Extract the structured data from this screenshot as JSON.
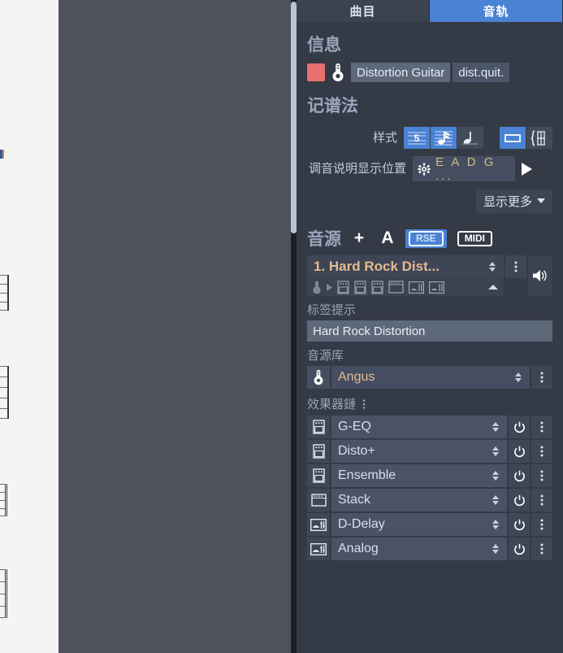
{
  "tabs": [
    {
      "label": "曲目",
      "active": false,
      "name": "tab-songs"
    },
    {
      "label": "音轨",
      "active": true,
      "name": "tab-tracks"
    }
  ],
  "info": {
    "heading": "信息",
    "color_swatch": "#e8706e",
    "instrument_name": "Distortion Guitar",
    "short_name": "dist.quit."
  },
  "notation": {
    "heading": "记谱法",
    "style_label": "样式",
    "style_buttons": [
      {
        "icon": "tab-number-icon",
        "active": true
      },
      {
        "icon": "standard-notation-icon",
        "active": true
      },
      {
        "icon": "slash-notation-icon",
        "active": false
      },
      {
        "icon": "single-staff-icon",
        "active": true
      },
      {
        "icon": "grand-staff-icon",
        "active": false
      }
    ],
    "tuning_label": "调音说明显示位置",
    "tuning_value": "E A D G ...",
    "show_more_label": "显示更多"
  },
  "source": {
    "heading": "音源",
    "buttons": [
      {
        "label": "+",
        "name": "add-source-button"
      },
      {
        "label": "A",
        "name": "automation-button"
      }
    ],
    "modes": [
      {
        "label": "RSE",
        "active": true
      },
      {
        "label": "MIDI",
        "active": false
      }
    ],
    "preset_name": "1. Hard Rock Dist...",
    "tag_label": "标签提示",
    "tag_value": "Hard Rock Distortion",
    "library_label": "音源库",
    "library_value": "Angus",
    "chain_label": "效果器鏈",
    "effects": [
      {
        "name": "G-EQ",
        "icon": "pedal-icon",
        "enabled": true
      },
      {
        "name": "Disto+",
        "icon": "pedal-icon",
        "enabled": true
      },
      {
        "name": "Ensemble",
        "icon": "pedal-icon",
        "enabled": true
      },
      {
        "name": "Stack",
        "icon": "amp-stack-icon",
        "enabled": true
      },
      {
        "name": "D-Delay",
        "icon": "rack-unit-icon",
        "enabled": true
      },
      {
        "name": "Analog",
        "icon": "rack-unit-icon",
        "enabled": true
      }
    ]
  }
}
